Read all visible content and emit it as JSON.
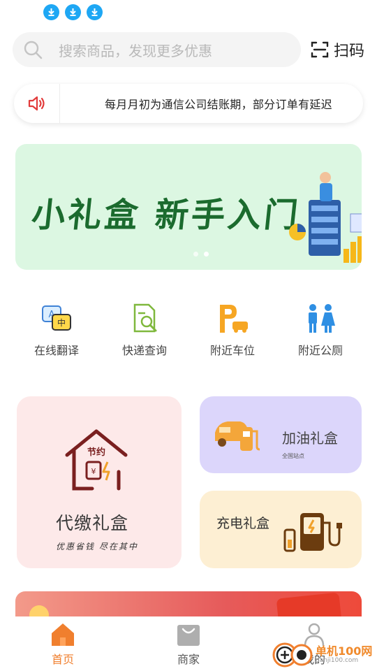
{
  "status_bar": {
    "icons": [
      "download-icon",
      "download-icon",
      "download-icon"
    ]
  },
  "search": {
    "placeholder": "搜索商品，发现更多优惠",
    "scan_label": "扫码"
  },
  "notice": {
    "text": "每月月初为通信公司结账期，部分订单有延迟"
  },
  "banner": {
    "text": "小礼盒 新手入门",
    "slide_count": 2,
    "active_slide": 1
  },
  "services": [
    {
      "label": "在线翻译",
      "icon": "translate-icon"
    },
    {
      "label": "快递查询",
      "icon": "express-query-icon"
    },
    {
      "label": "附近车位",
      "icon": "parking-icon"
    },
    {
      "label": "附近公厕",
      "icon": "restroom-icon"
    }
  ],
  "cards": {
    "daijiao": {
      "title": "代缴礼盒",
      "subtitle": "优惠省钱 尽在其中",
      "badge": "节约"
    },
    "jiayou": {
      "title": "加油礼盒",
      "subtitle": "全国站点"
    },
    "chongdian": {
      "title": "充电礼盒"
    }
  },
  "tabbar": {
    "items": [
      {
        "label": "首页",
        "icon": "home-icon",
        "active": true
      },
      {
        "label": "商家",
        "icon": "shopping-bag-icon",
        "active": false
      },
      {
        "label": "我的",
        "icon": "user-icon",
        "active": false
      }
    ]
  },
  "watermark": {
    "text": "单机100网",
    "url": "danji100.com"
  },
  "colors": {
    "accent": "#f07f2e",
    "banner_bg": "#dcf7e2",
    "banner_text": "#1b6b2e"
  }
}
